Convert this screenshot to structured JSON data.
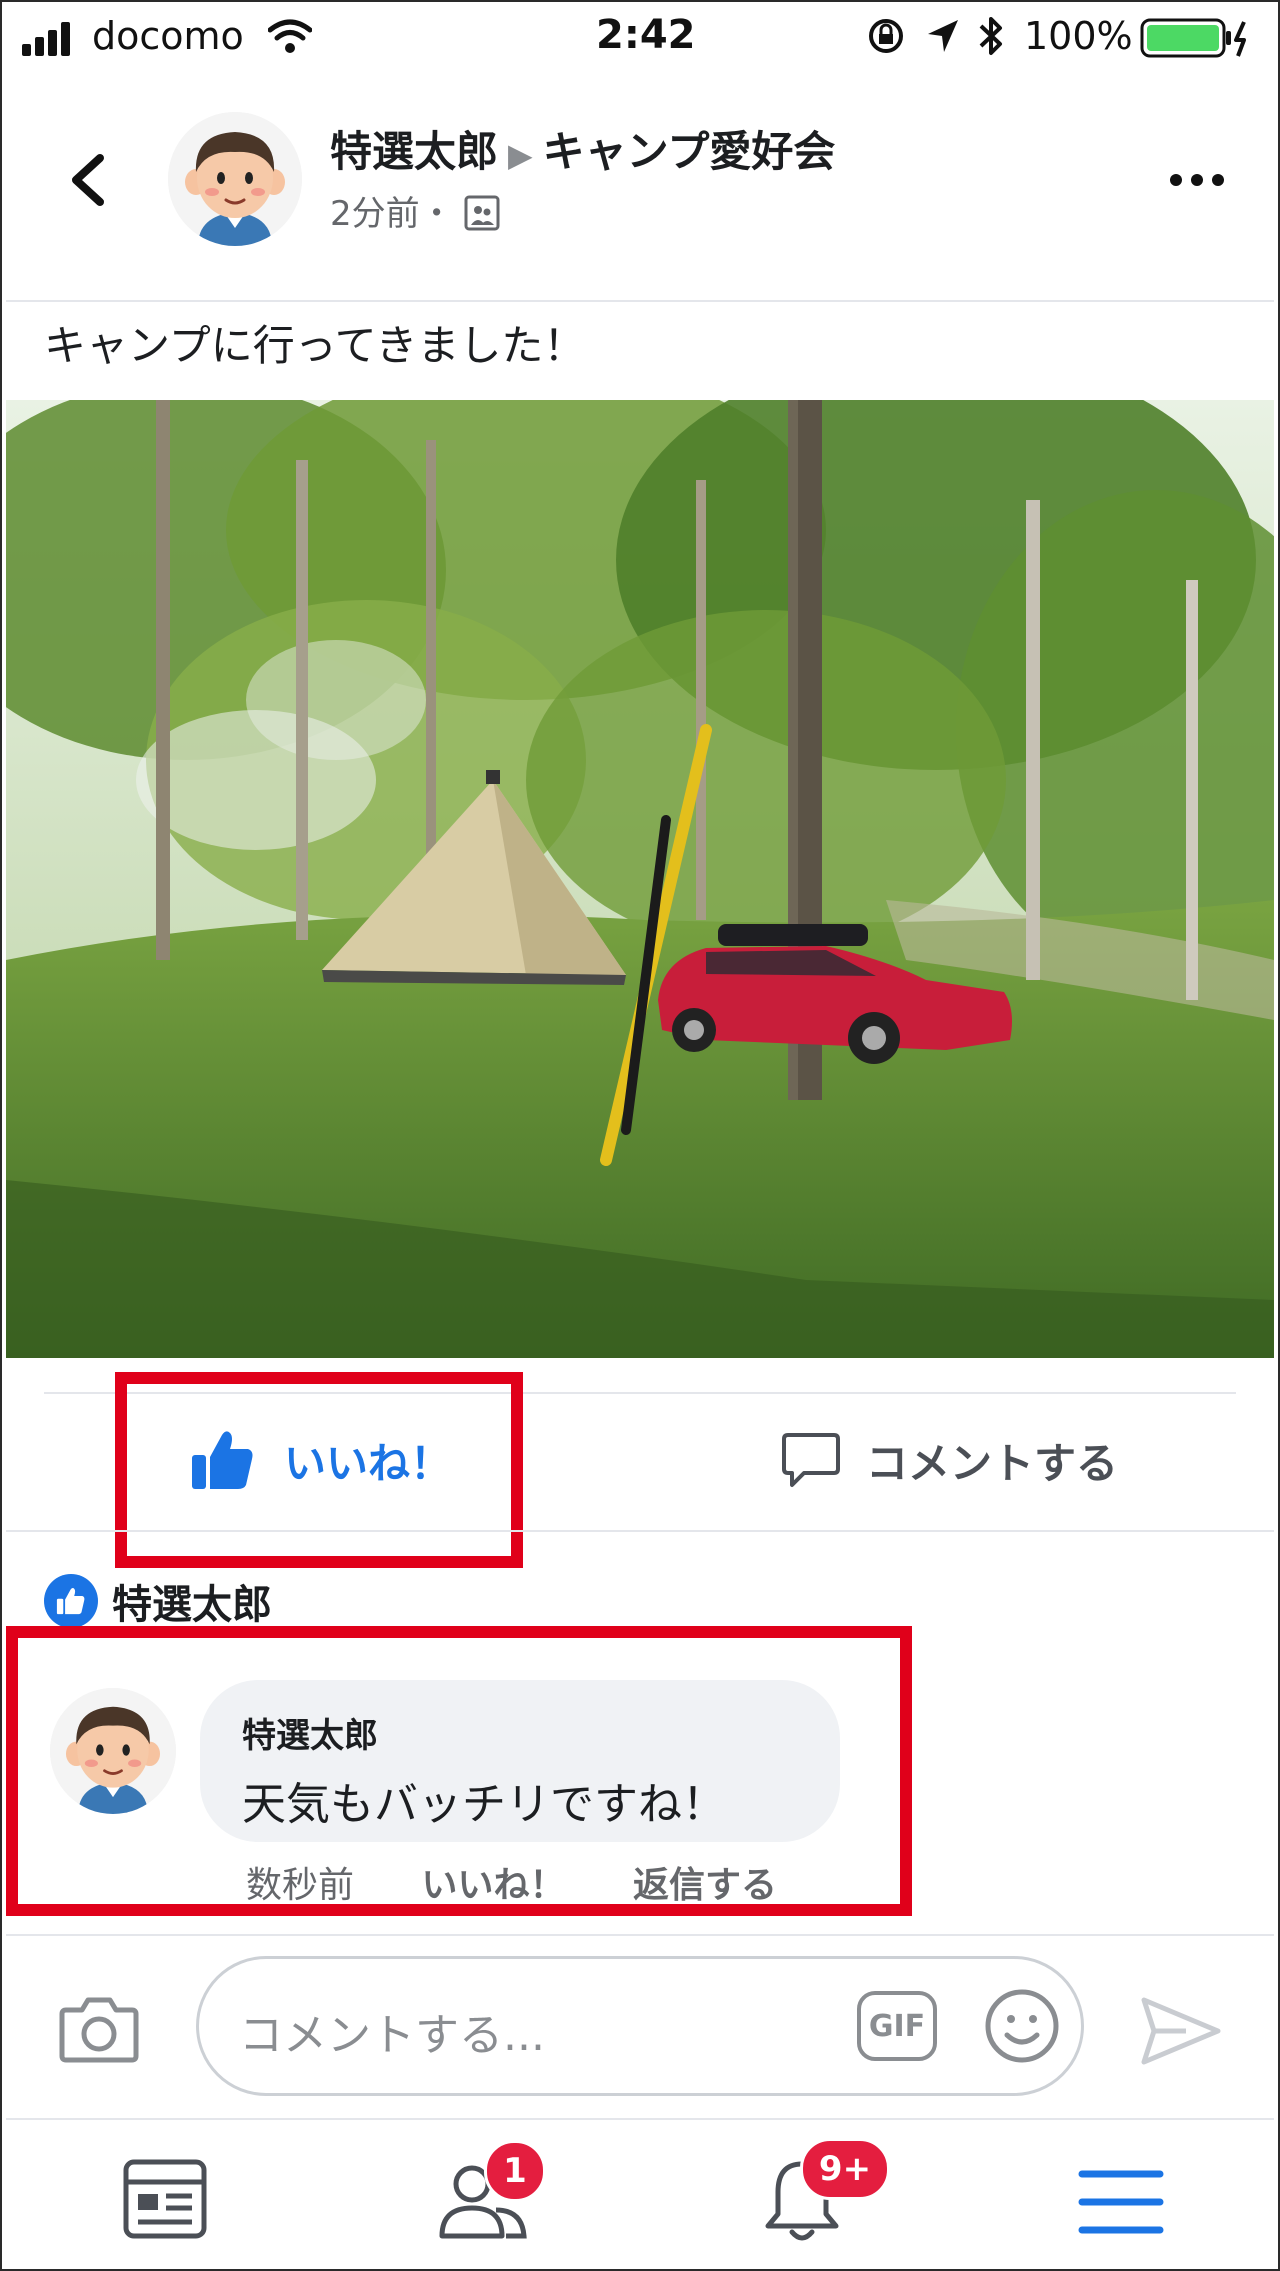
{
  "status_bar": {
    "carrier": "docomo",
    "time": "2:42",
    "battery_percent": "100%"
  },
  "post": {
    "author": "特選太郎",
    "group": "キャンプ愛好会",
    "time_ago": "2分前",
    "separator": "・",
    "text": "キャンプに行ってきました！"
  },
  "actions": {
    "like_label": "いいね！",
    "comment_label": "コメントする"
  },
  "reactions": {
    "liked_by": "特選太郎"
  },
  "comment": {
    "author": "特選太郎",
    "text": "天気もバッチリですね！",
    "time": "数秒前",
    "like": "いいね！",
    "reply": "返信する"
  },
  "composer": {
    "placeholder": "コメントする...",
    "gif_label": "GIF"
  },
  "tab_bar": {
    "friends_badge": "1",
    "notifications_badge": "9+"
  },
  "colors": {
    "accent_blue": "#1b74e4",
    "highlight_red": "#e0001a",
    "badge_red": "#e41e3f"
  }
}
